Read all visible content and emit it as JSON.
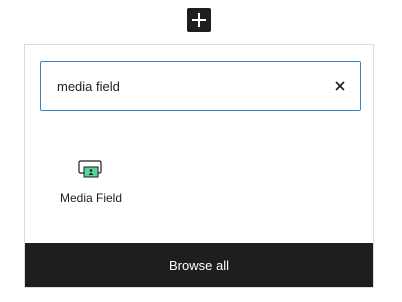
{
  "inserter_toggle": {
    "icon": "plus-icon"
  },
  "search": {
    "value": "media field",
    "clear_icon": "close-icon"
  },
  "results": [
    {
      "label": "Media Field",
      "icon": "media-field-icon",
      "icon_color": "#5bd49b"
    }
  ],
  "footer": {
    "browse_all_label": "Browse all"
  },
  "colors": {
    "accent": "#3582c4",
    "dark": "#1e1e1e"
  }
}
